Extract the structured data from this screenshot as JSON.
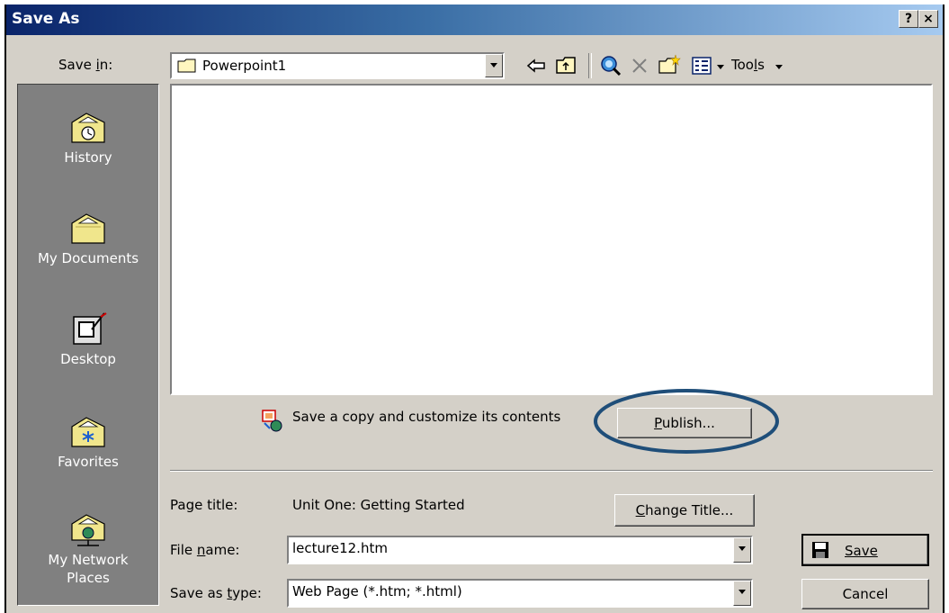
{
  "window": {
    "title": "Save As",
    "help_btn": "?",
    "close_btn": "×"
  },
  "toolbar": {
    "save_in_label": "Save in:",
    "save_in_value": "Powerpoint1",
    "tools_label": "Tools"
  },
  "places": [
    {
      "label": "History"
    },
    {
      "label": "My Documents"
    },
    {
      "label": "Desktop"
    },
    {
      "label": "Favorites"
    },
    {
      "label": "My Network Places"
    }
  ],
  "publish": {
    "text": "Save a copy and customize its contents",
    "button": "Publish..."
  },
  "form": {
    "page_title_label": "Page title:",
    "page_title_value": "Unit One: Getting Started",
    "change_title_button": "Change Title...",
    "file_name_label": "File name:",
    "file_name_value": "lecture12.htm",
    "save_as_type_label": "Save as type:",
    "save_as_type_value": "Web Page (*.htm; *.html)",
    "save_button": "Save",
    "cancel_button": "Cancel"
  },
  "colors": {
    "titlebar_start": "#0a246a",
    "titlebar_end": "#a6caf0",
    "dialog_bg": "#d4d0c8",
    "places_bg": "#808080",
    "highlight_ellipse": "#1f4e79"
  }
}
